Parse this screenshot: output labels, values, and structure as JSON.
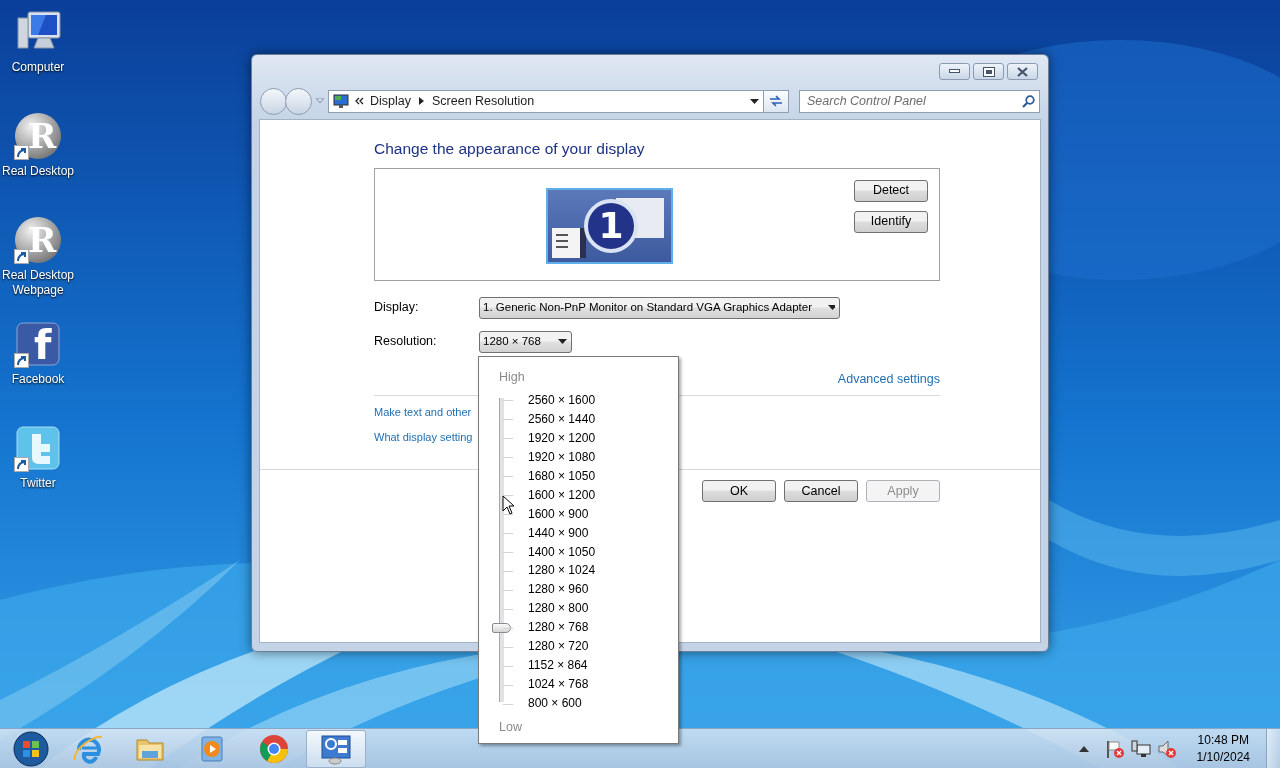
{
  "desktop_icons": [
    {
      "label": "Computer",
      "kind": "computer",
      "shortcut": false
    },
    {
      "label": "Real Desktop",
      "kind": "orb",
      "glyph": "R",
      "shortcut": true
    },
    {
      "label": "Real Desktop Webpage",
      "kind": "orb",
      "glyph": "R",
      "shortcut": true
    },
    {
      "label": "Facebook",
      "kind": "tile",
      "glyph": "f",
      "shortcut": true
    },
    {
      "label": "Twitter",
      "kind": "bird",
      "shortcut": true
    }
  ],
  "window": {
    "breadcrumb": [
      "Display",
      "Screen Resolution"
    ],
    "search": {
      "placeholder": "Search Control Panel"
    },
    "heading": "Change the appearance of your display",
    "monitor_number": "1",
    "side_buttons": [
      "Detect",
      "Identify"
    ],
    "display": {
      "label": "Display:",
      "value": "1. Generic Non-PnP Monitor on Standard VGA Graphics Adapter"
    },
    "resolution": {
      "label": "Resolution:",
      "value": "1280 × 768"
    },
    "advanced_link": "Advanced settings",
    "links": [
      "Make text and other",
      "What display setting"
    ],
    "buttons": [
      {
        "label": "OK",
        "disabled": false
      },
      {
        "label": "Cancel",
        "disabled": false
      },
      {
        "label": "Apply",
        "disabled": true
      }
    ]
  },
  "resolution_menu": {
    "high_label": "High",
    "low_label": "Low",
    "level": 0.25,
    "options": [
      "2560 × 1600",
      "2560 × 1440",
      "1920 × 1200",
      "1920 × 1080",
      "1680 × 1050",
      "1600 × 1200",
      "1600 × 900",
      "1440 × 900",
      "1400 × 1050",
      "1280 × 1024",
      "1280 × 960",
      "1280 × 800",
      "1280 × 768",
      "1280 × 720",
      "1152 × 864",
      "1024 × 768",
      "800 × 600"
    ]
  },
  "taskbar": {
    "apps": [
      {
        "kind": "ie",
        "active": false
      },
      {
        "kind": "folder",
        "active": false
      },
      {
        "kind": "media",
        "active": false
      },
      {
        "kind": "chrome",
        "active": false
      },
      {
        "kind": "display",
        "active": true
      }
    ],
    "clock": {
      "time": "10:48 PM",
      "date": "1/10/2024"
    }
  }
}
